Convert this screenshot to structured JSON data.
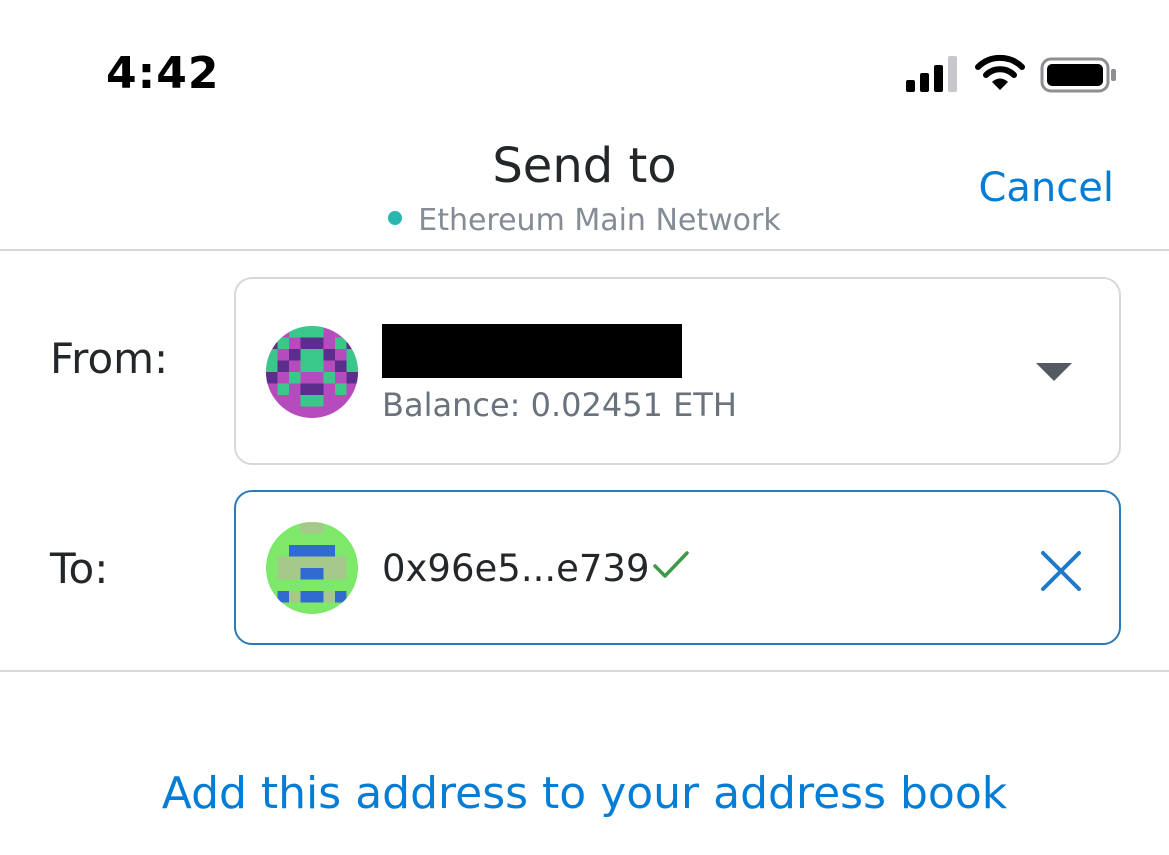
{
  "status_bar": {
    "time": "4:42",
    "signal_icon": "cellular-signal-icon",
    "wifi_icon": "wifi-icon",
    "battery_icon": "battery-icon"
  },
  "header": {
    "title": "Send to",
    "network": "Ethereum Main Network",
    "network_status_color": "#29b6af",
    "cancel_label": "Cancel"
  },
  "from": {
    "label": "From:",
    "balance": "Balance: 0.02451 ETH",
    "account_name_redacted": true,
    "dropdown_icon": "caret-down-icon"
  },
  "to": {
    "label": "To:",
    "address": "0x96e5...e739",
    "verified_icon": "checkmark-icon",
    "clear_icon": "close-icon"
  },
  "actions": {
    "add_to_address_book": "Add this address to your address book"
  },
  "colors": {
    "accent": "#037dd6",
    "active_border": "#2c7ab8",
    "verified": "#3f9a47"
  }
}
